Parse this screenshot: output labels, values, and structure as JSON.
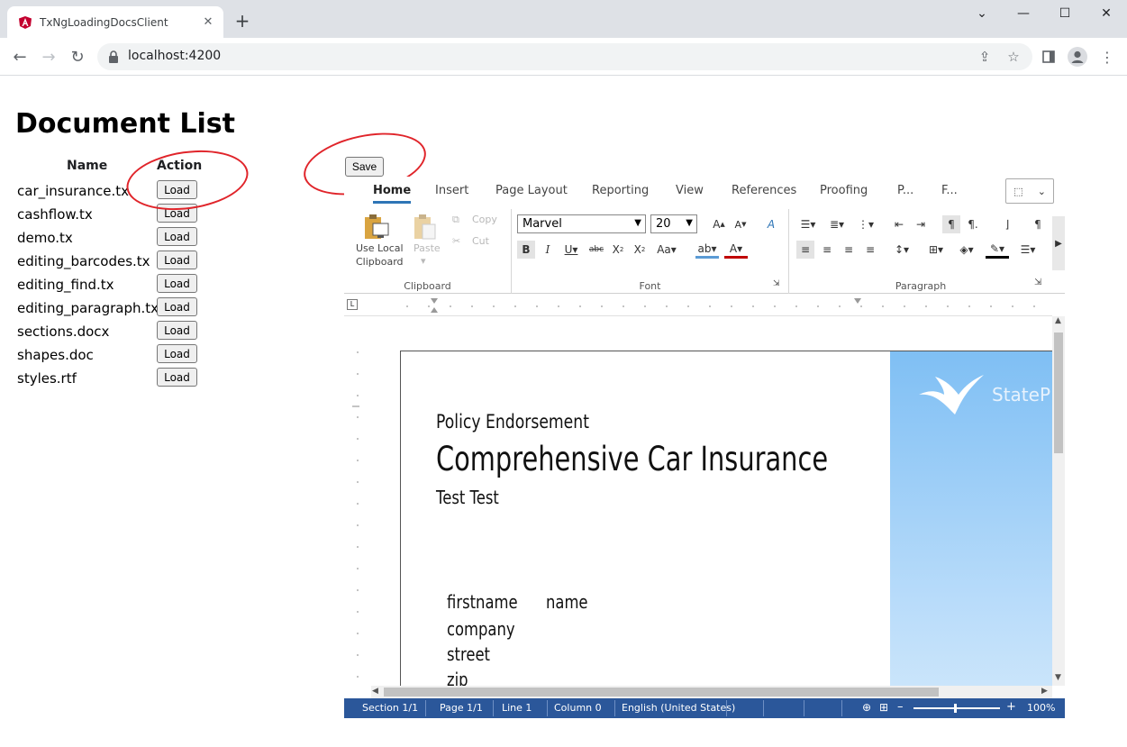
{
  "browser": {
    "tab_title": "TxNgLoadingDocsClient",
    "url": "localhost:4200",
    "icons": [
      "angular-favicon",
      "close-icon",
      "plus-icon",
      "minimize-icon",
      "maximize-icon",
      "close-window-icon",
      "back-icon",
      "forward-icon",
      "reload-icon",
      "lock-icon",
      "share-icon",
      "star-icon",
      "sidebar-icon",
      "profile-icon",
      "menu-icon"
    ]
  },
  "page": {
    "title": "Document List",
    "save_label": "Save",
    "table": {
      "headers": [
        "Name",
        "Action"
      ],
      "rows": [
        {
          "name": "car_insurance.tx",
          "action": "Load"
        },
        {
          "name": "cashflow.tx",
          "action": "Load"
        },
        {
          "name": "demo.tx",
          "action": "Load"
        },
        {
          "name": "editing_barcodes.tx",
          "action": "Load"
        },
        {
          "name": "editing_find.tx",
          "action": "Load"
        },
        {
          "name": "editing_paragraph.tx",
          "action": "Load"
        },
        {
          "name": "sections.docx",
          "action": "Load"
        },
        {
          "name": "shapes.doc",
          "action": "Load"
        },
        {
          "name": "styles.rtf",
          "action": "Load"
        }
      ]
    },
    "annotation_color": "#e0242a"
  },
  "editor": {
    "ribbon_tabs": [
      "Home",
      "Insert",
      "Page Layout",
      "Reporting",
      "View",
      "References",
      "Proofing",
      "P...",
      "F..."
    ],
    "active_tab": "Home",
    "groups": {
      "clipboard": {
        "label": "Clipboard",
        "use_local": "Use Local",
        "clipboard_word": "Clipboard",
        "paste": "Paste",
        "copy": "Copy",
        "cut": "Cut"
      },
      "font": {
        "label": "Font",
        "font_name": "Marvel",
        "font_size": "20"
      },
      "paragraph": {
        "label": "Paragraph"
      }
    },
    "document": {
      "line1": "Policy Endorsement",
      "line2": "Comprehensive Car Insurance",
      "line3": "Test Test",
      "fields": [
        "firstname",
        "name",
        "company",
        "street",
        "zip"
      ],
      "logo_text": "StateP"
    },
    "status_bar": {
      "section": "Section 1/1",
      "page": "Page 1/1",
      "line": "Line 1",
      "column": "Column 0",
      "language": "English (United States)",
      "zoom": "100%",
      "zoom_minus": "–",
      "zoom_plus": "+",
      "accent": "#2b579a"
    }
  }
}
